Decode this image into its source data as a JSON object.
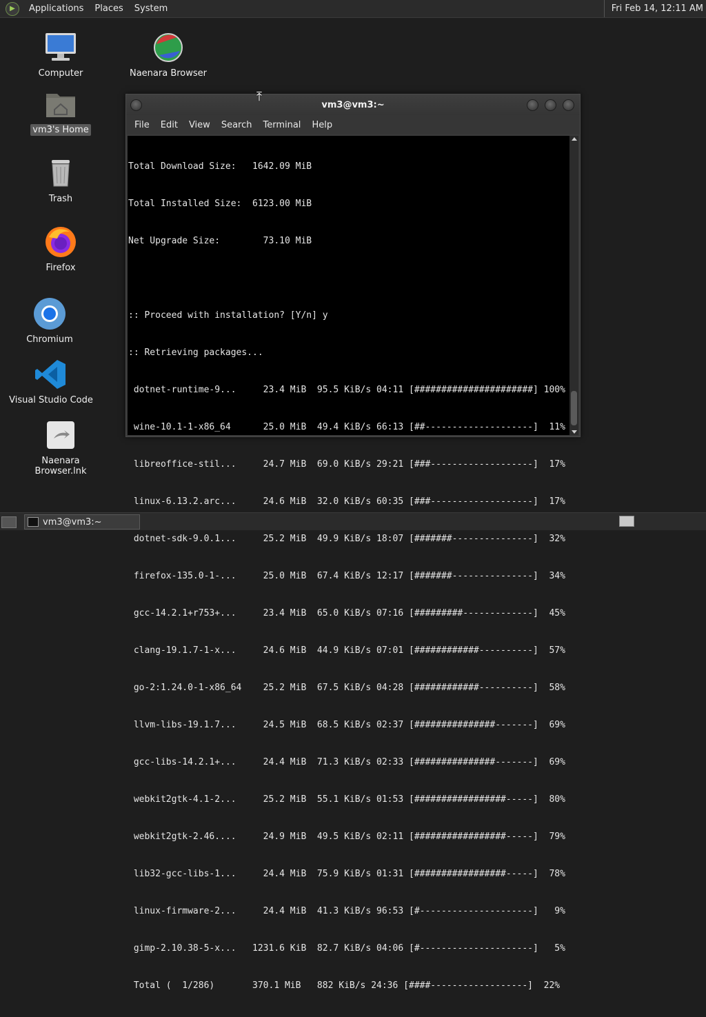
{
  "top_panel": {
    "menus": [
      "Applications",
      "Places",
      "System"
    ],
    "clock": "Fri Feb 14, 12:11 AM"
  },
  "desktop": {
    "icons": [
      {
        "label": "Computer",
        "icon": "computer-icon"
      },
      {
        "label": "vm3's Home",
        "icon": "home-folder-icon"
      },
      {
        "label": "Trash",
        "icon": "trash-icon"
      },
      {
        "label": "Firefox",
        "icon": "firefox-icon"
      },
      {
        "label": "Chromium",
        "icon": "chromium-icon"
      },
      {
        "label": "Visual Studio Code",
        "icon": "vscode-icon"
      },
      {
        "label": "Naenara Browser.lnk",
        "icon": "shortcut-icon"
      },
      {
        "label": "Naenara Browser",
        "icon": "naenara-browser-icon"
      }
    ]
  },
  "terminal": {
    "title": "vm3@vm3:~",
    "menu": [
      "File",
      "Edit",
      "View",
      "Search",
      "Terminal",
      "Help"
    ],
    "summary": [
      "Total Download Size:   1642.09 MiB",
      "Total Installed Size:  6123.00 MiB",
      "Net Upgrade Size:        73.10 MiB",
      "",
      ":: Proceed with installation? [Y/n] y",
      ":: Retrieving packages..."
    ],
    "packages": [
      " dotnet-runtime-9...     23.4 MiB  95.5 KiB/s 04:11 [######################] 100%",
      " wine-10.1-1-x86_64      25.0 MiB  49.4 KiB/s 66:13 [##--------------------]  11%",
      " libreoffice-stil...     24.7 MiB  69.0 KiB/s 29:21 [###-------------------]  17%",
      " linux-6.13.2.arc...     24.6 MiB  32.0 KiB/s 60:35 [###-------------------]  17%",
      " dotnet-sdk-9.0.1...     25.2 MiB  49.9 KiB/s 18:07 [#######---------------]  32%",
      " firefox-135.0-1-...     25.0 MiB  67.4 KiB/s 12:17 [#######---------------]  34%",
      " gcc-14.2.1+r753+...     23.4 MiB  65.0 KiB/s 07:16 [#########-------------]  45%",
      " clang-19.1.7-1-x...     24.6 MiB  44.9 KiB/s 07:01 [############----------]  57%",
      " go-2:1.24.0-1-x86_64    25.2 MiB  67.5 KiB/s 04:28 [############----------]  58%",
      " llvm-libs-19.1.7...     24.5 MiB  68.5 KiB/s 02:37 [###############-------]  69%",
      " gcc-libs-14.2.1+...     24.4 MiB  71.3 KiB/s 02:33 [###############-------]  69%",
      " webkit2gtk-4.1-2...     25.2 MiB  55.1 KiB/s 01:53 [#################-----]  80%",
      " webkit2gtk-2.46....     24.9 MiB  49.5 KiB/s 02:11 [#################-----]  79%",
      " lib32-gcc-libs-1...     24.4 MiB  75.9 KiB/s 01:31 [#################-----]  78%",
      " linux-firmware-2...     24.4 MiB  41.3 KiB/s 96:53 [#---------------------]   9%",
      " gimp-2.10.38-5-x...   1231.6 KiB  82.7 KiB/s 04:06 [#---------------------]   5%",
      " Total (  1/286)       370.1 MiB   882 KiB/s 24:36 [####------------------]  22%"
    ]
  },
  "taskbar": {
    "window_button": "vm3@vm3:~"
  }
}
